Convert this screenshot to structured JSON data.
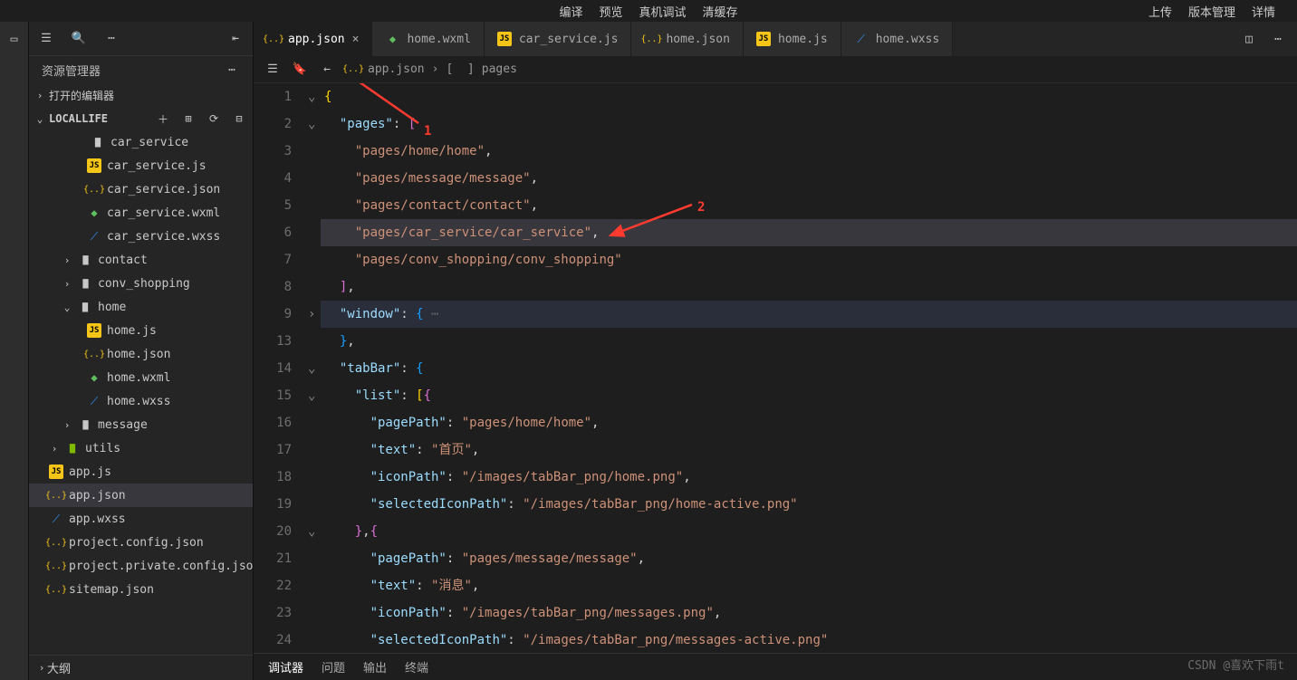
{
  "top_menu": {
    "center": [
      "编译",
      "预览",
      "真机调试",
      "清缓存"
    ],
    "right": [
      "上传",
      "版本管理",
      "详情"
    ]
  },
  "sidebar": {
    "title": "资源管理器",
    "sections": {
      "open_editors": "打开的编辑器",
      "project": "LOCALLIFE",
      "outline": "大纲"
    },
    "tree": [
      {
        "indent": 3,
        "type": "folder-open",
        "label": "car_service",
        "chev": ""
      },
      {
        "indent": 4,
        "type": "js",
        "label": "car_service.js"
      },
      {
        "indent": 4,
        "type": "json",
        "label": "car_service.json"
      },
      {
        "indent": 4,
        "type": "wxml",
        "label": "car_service.wxml"
      },
      {
        "indent": 4,
        "type": "wxss",
        "label": "car_service.wxss"
      },
      {
        "indent": 2,
        "type": "folder",
        "label": "contact",
        "chev": "›"
      },
      {
        "indent": 2,
        "type": "folder",
        "label": "conv_shopping",
        "chev": "›"
      },
      {
        "indent": 2,
        "type": "folder-open",
        "label": "home",
        "chev": "⌄"
      },
      {
        "indent": 4,
        "type": "js",
        "label": "home.js"
      },
      {
        "indent": 4,
        "type": "json",
        "label": "home.json"
      },
      {
        "indent": 4,
        "type": "wxml",
        "label": "home.wxml"
      },
      {
        "indent": 4,
        "type": "wxss",
        "label": "home.wxss"
      },
      {
        "indent": 2,
        "type": "folder",
        "label": "message",
        "chev": "›"
      },
      {
        "indent": 1,
        "type": "utils",
        "label": "utils",
        "chev": "›"
      },
      {
        "indent": 1,
        "type": "js",
        "label": "app.js"
      },
      {
        "indent": 1,
        "type": "json",
        "label": "app.json",
        "selected": true
      },
      {
        "indent": 1,
        "type": "wxss",
        "label": "app.wxss"
      },
      {
        "indent": 1,
        "type": "json",
        "label": "project.config.json"
      },
      {
        "indent": 1,
        "type": "json",
        "label": "project.private.config.json"
      },
      {
        "indent": 1,
        "type": "json",
        "label": "sitemap.json"
      }
    ]
  },
  "tabs": [
    {
      "icon": "json",
      "label": "app.json",
      "active": true,
      "closable": true
    },
    {
      "icon": "wxml",
      "label": "home.wxml"
    },
    {
      "icon": "js",
      "label": "car_service.js"
    },
    {
      "icon": "json",
      "label": "home.json"
    },
    {
      "icon": "js",
      "label": "home.js"
    },
    {
      "icon": "wxss",
      "label": "home.wxss"
    }
  ],
  "breadcrumb": {
    "file": "app.json",
    "symbol": "pages"
  },
  "annotations": {
    "a1": "1",
    "a2": "2"
  },
  "code": {
    "lines": [
      {
        "n": 1,
        "fold": "⌄",
        "html": "<span class='t-brace'>{</span>"
      },
      {
        "n": 2,
        "fold": "⌄",
        "html": "  <span class='t-key'>\"pages\"</span><span class='t-punc'>:</span> <span class='t-brack'>[</span>",
        "hl": false
      },
      {
        "n": 3,
        "html": "    <span class='t-str'>\"pages/home/home\"</span><span class='t-punc'>,</span>"
      },
      {
        "n": 4,
        "html": "    <span class='t-str'>\"pages/message/message\"</span><span class='t-punc'>,</span>"
      },
      {
        "n": 5,
        "html": "    <span class='t-str'>\"pages/contact/contact\"</span><span class='t-punc'>,</span>"
      },
      {
        "n": 6,
        "html": "    <span class='t-str'>\"pages/car_service/car_service\"</span><span class='t-punc'>,</span>",
        "sel": true
      },
      {
        "n": 7,
        "html": "    <span class='t-str'>\"pages/conv_shopping/conv_shopping\"</span>"
      },
      {
        "n": 8,
        "html": "  <span class='t-brack'>]</span><span class='t-punc'>,</span>"
      },
      {
        "n": 9,
        "fold": "›",
        "html": "  <span class='t-key'>\"window\"</span><span class='t-punc'>:</span> <span class='t-brace2'>{</span><span class='t-dim'> ⋯</span>",
        "hl": true
      },
      {
        "n": 13,
        "html": "  <span class='t-brace2'>}</span><span class='t-punc'>,</span>"
      },
      {
        "n": 14,
        "fold": "⌄",
        "html": "  <span class='t-key'>\"tabBar\"</span><span class='t-punc'>:</span> <span class='t-brace2'>{</span>"
      },
      {
        "n": 15,
        "fold": "⌄",
        "html": "    <span class='t-key'>\"list\"</span><span class='t-punc'>:</span> <span class='t-brace'>[</span><span class='t-brack'>{</span>"
      },
      {
        "n": 16,
        "html": "      <span class='t-key'>\"pagePath\"</span><span class='t-punc'>:</span> <span class='t-str'>\"pages/home/home\"</span><span class='t-punc'>,</span>"
      },
      {
        "n": 17,
        "html": "      <span class='t-key'>\"text\"</span><span class='t-punc'>:</span> <span class='t-str'>\"首页\"</span><span class='t-punc'>,</span>"
      },
      {
        "n": 18,
        "html": "      <span class='t-key'>\"iconPath\"</span><span class='t-punc'>:</span> <span class='t-str'>\"/images/tabBar_png/home.png\"</span><span class='t-punc'>,</span>"
      },
      {
        "n": 19,
        "html": "      <span class='t-key'>\"selectedIconPath\"</span><span class='t-punc'>:</span> <span class='t-str'>\"/images/tabBar_png/home-active.png\"</span>"
      },
      {
        "n": 20,
        "fold": "⌄",
        "html": "    <span class='t-brack'>}</span><span class='t-punc'>,</span><span class='t-brack'>{</span>"
      },
      {
        "n": 21,
        "html": "      <span class='t-key'>\"pagePath\"</span><span class='t-punc'>:</span> <span class='t-str'>\"pages/message/message\"</span><span class='t-punc'>,</span>"
      },
      {
        "n": 22,
        "html": "      <span class='t-key'>\"text\"</span><span class='t-punc'>:</span> <span class='t-str'>\"消息\"</span><span class='t-punc'>,</span>"
      },
      {
        "n": 23,
        "html": "      <span class='t-key'>\"iconPath\"</span><span class='t-punc'>:</span> <span class='t-str'>\"/images/tabBar_png/messages.png\"</span><span class='t-punc'>,</span>"
      },
      {
        "n": 24,
        "html": "      <span class='t-key'>\"selectedIconPath\"</span><span class='t-punc'>:</span> <span class='t-str'>\"/images/tabBar_png/messages-active.png\"</span>"
      }
    ]
  },
  "bottom_panel": {
    "tabs": [
      "调试器",
      "问题",
      "输出",
      "终端"
    ]
  },
  "watermark": "CSDN @喜欢下雨t"
}
